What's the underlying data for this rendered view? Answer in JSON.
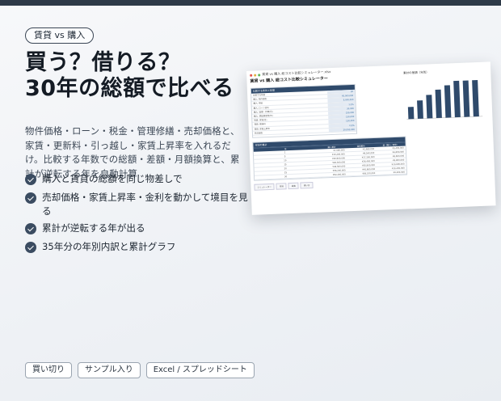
{
  "badge": "賃貸 vs 購入",
  "headline": {
    "line1": "買う？借りる？",
    "line2": "30年の総額で比べる"
  },
  "description": "物件価格・ローン・税金・管理修繕・売却価格と、家賃・更新料・引っ越し・家賃上昇率を入れるだけ。比較する年数での総額・差額・月額換算と、累計が逆転する年を自動計算",
  "features": [
    "購入と賃貸の総額を同じ物差しで",
    "売却価格・家賃上昇率・金利を動かして境目を見る",
    "累計が逆転する年が出る",
    "35年分の年別内訳と累計グラフ"
  ],
  "tags": [
    "買い切り",
    "サンプル入り",
    "Excel / スプレッドシート"
  ],
  "colors": {
    "accent": "#3b4c61",
    "topbar": "#2e3a48",
    "sheet_header": "#2f4a6b"
  },
  "sheet": {
    "window_title": "賃貸 vs 購入 総コスト比較シミュレーター.xlsx",
    "heading": "賃貸 vs 購入 総コスト比較シミュレーター",
    "params_header": "比較する条件と前提",
    "params": [
      {
        "k": "比較する年数",
        "v": "30"
      },
      {
        "k": "購入: 物件価格",
        "v": "45,000,000"
      },
      {
        "k": "購入: 頭金",
        "v": "5,000,000"
      },
      {
        "k": "購入: ローン金利",
        "v": "1.2%"
      },
      {
        "k": "購入: 管理・修繕(月)",
        "v": "30,000"
      },
      {
        "k": "購入: 固定資産税(年)",
        "v": "150,000"
      },
      {
        "k": "賃貸: 家賃(月)",
        "v": "130,000"
      },
      {
        "k": "賃貸: 更新料",
        "v": "130,000"
      },
      {
        "k": "賃貸: 家賃上昇率",
        "v": "0.5%"
      },
      {
        "k": "売却価格",
        "v": "20,000,000"
      }
    ],
    "chart_title": "累計の差額（年別）",
    "chart_bars": [
      0.3,
      0.45,
      0.58,
      0.7,
      0.8,
      0.9,
      0.9,
      0.9
    ],
    "results_header": "年別の累計",
    "results_cols": [
      "年",
      "購入累計",
      "賃貸累計",
      "差（購入−賃貸）"
    ],
    "results_rows": [
      [
        "1",
        "¥7,090,000",
        "¥1,690,000",
        "¥5,400,000"
      ],
      [
        "5",
        "¥15,200,000",
        "¥8,540,000",
        "¥6,660,000"
      ],
      [
        "10",
        "¥25,900,000",
        "¥17,300,000",
        "¥8,600,000"
      ],
      [
        "15",
        "¥36,300,000",
        "¥26,400,000",
        "¥9,900,000"
      ],
      [
        "20",
        "¥46,500,000",
        "¥35,900,000",
        "¥10,600,000"
      ],
      [
        "25",
        "¥56,200,000",
        "¥45,800,000",
        "¥10,400,000"
      ],
      [
        "30",
        "¥62,400,000",
        "¥56,100,000",
        "¥6,300,000"
      ]
    ],
    "sheet_tabs": [
      "シミュレーター",
      "年別",
      "設定",
      "使い方"
    ]
  }
}
